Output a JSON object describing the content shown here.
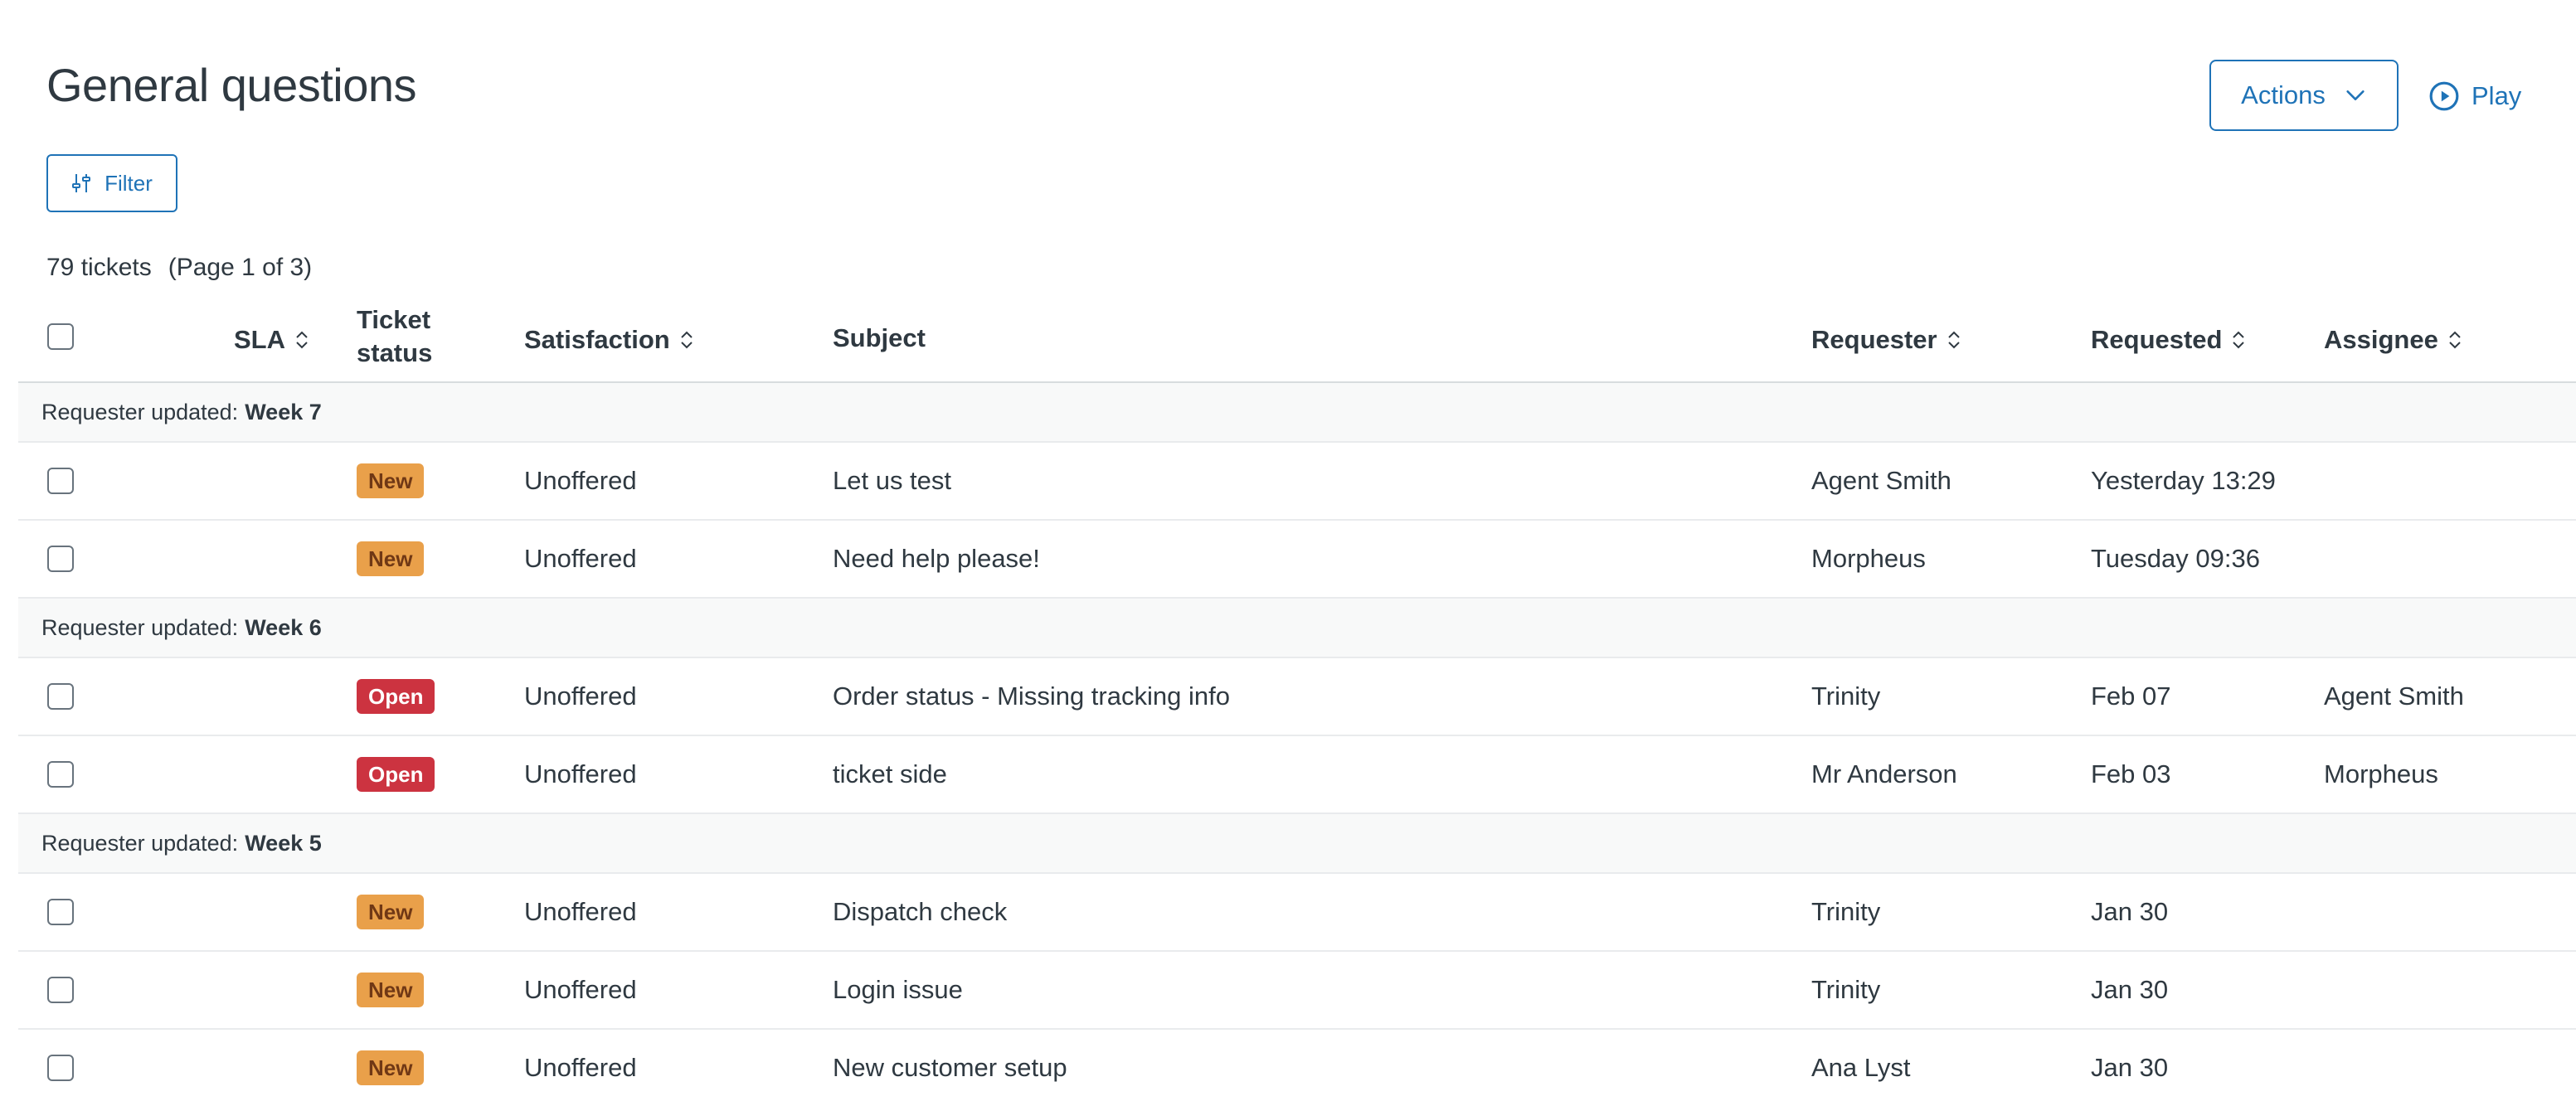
{
  "page": {
    "title": "General questions",
    "actions_label": "Actions",
    "play_label": "Play",
    "filter_label": "Filter",
    "ticket_count": "79 tickets",
    "page_info": "(Page 1 of 3)"
  },
  "columns": {
    "sla": "SLA",
    "ticket_status_line1": "Ticket",
    "ticket_status_line2": "status",
    "satisfaction": "Satisfaction",
    "subject": "Subject",
    "requester": "Requester",
    "requested": "Requested",
    "assignee": "Assignee"
  },
  "groups": [
    {
      "prefix": "Requester updated:",
      "label": "Week 7",
      "rows": [
        {
          "status": "New",
          "satisfaction": "Unoffered",
          "subject": "Let us test",
          "requester": "Agent Smith",
          "requested": "Yesterday 13:29",
          "assignee": ""
        },
        {
          "status": "New",
          "satisfaction": "Unoffered",
          "subject": "Need help please!",
          "requester": "Morpheus",
          "requested": "Tuesday 09:36",
          "assignee": ""
        }
      ]
    },
    {
      "prefix": "Requester updated:",
      "label": "Week 6",
      "rows": [
        {
          "status": "Open",
          "satisfaction": "Unoffered",
          "subject": "Order status - Missing tracking info",
          "requester": "Trinity",
          "requested": "Feb 07",
          "assignee": "Agent Smith"
        },
        {
          "status": "Open",
          "satisfaction": "Unoffered",
          "subject": "ticket side",
          "requester": "Mr Anderson",
          "requested": "Feb 03",
          "assignee": "Morpheus"
        }
      ]
    },
    {
      "prefix": "Requester updated:",
      "label": "Week 5",
      "rows": [
        {
          "status": "New",
          "satisfaction": "Unoffered",
          "subject": "Dispatch check",
          "requester": "Trinity",
          "requested": "Jan 30",
          "assignee": ""
        },
        {
          "status": "New",
          "satisfaction": "Unoffered",
          "subject": "Login issue",
          "requester": "Trinity",
          "requested": "Jan 30",
          "assignee": ""
        },
        {
          "status": "New",
          "satisfaction": "Unoffered",
          "subject": "New customer setup",
          "requester": "Ana Lyst",
          "requested": "Jan 30",
          "assignee": ""
        }
      ]
    }
  ],
  "colors": {
    "accent": "#1f73b7",
    "status_new": "#e9a04a",
    "status_open": "#cc3340"
  },
  "icons": {
    "actions": "chevron-down-icon",
    "play": "play-circle-icon",
    "filter": "sliders-icon",
    "sort": "sort-icon"
  }
}
